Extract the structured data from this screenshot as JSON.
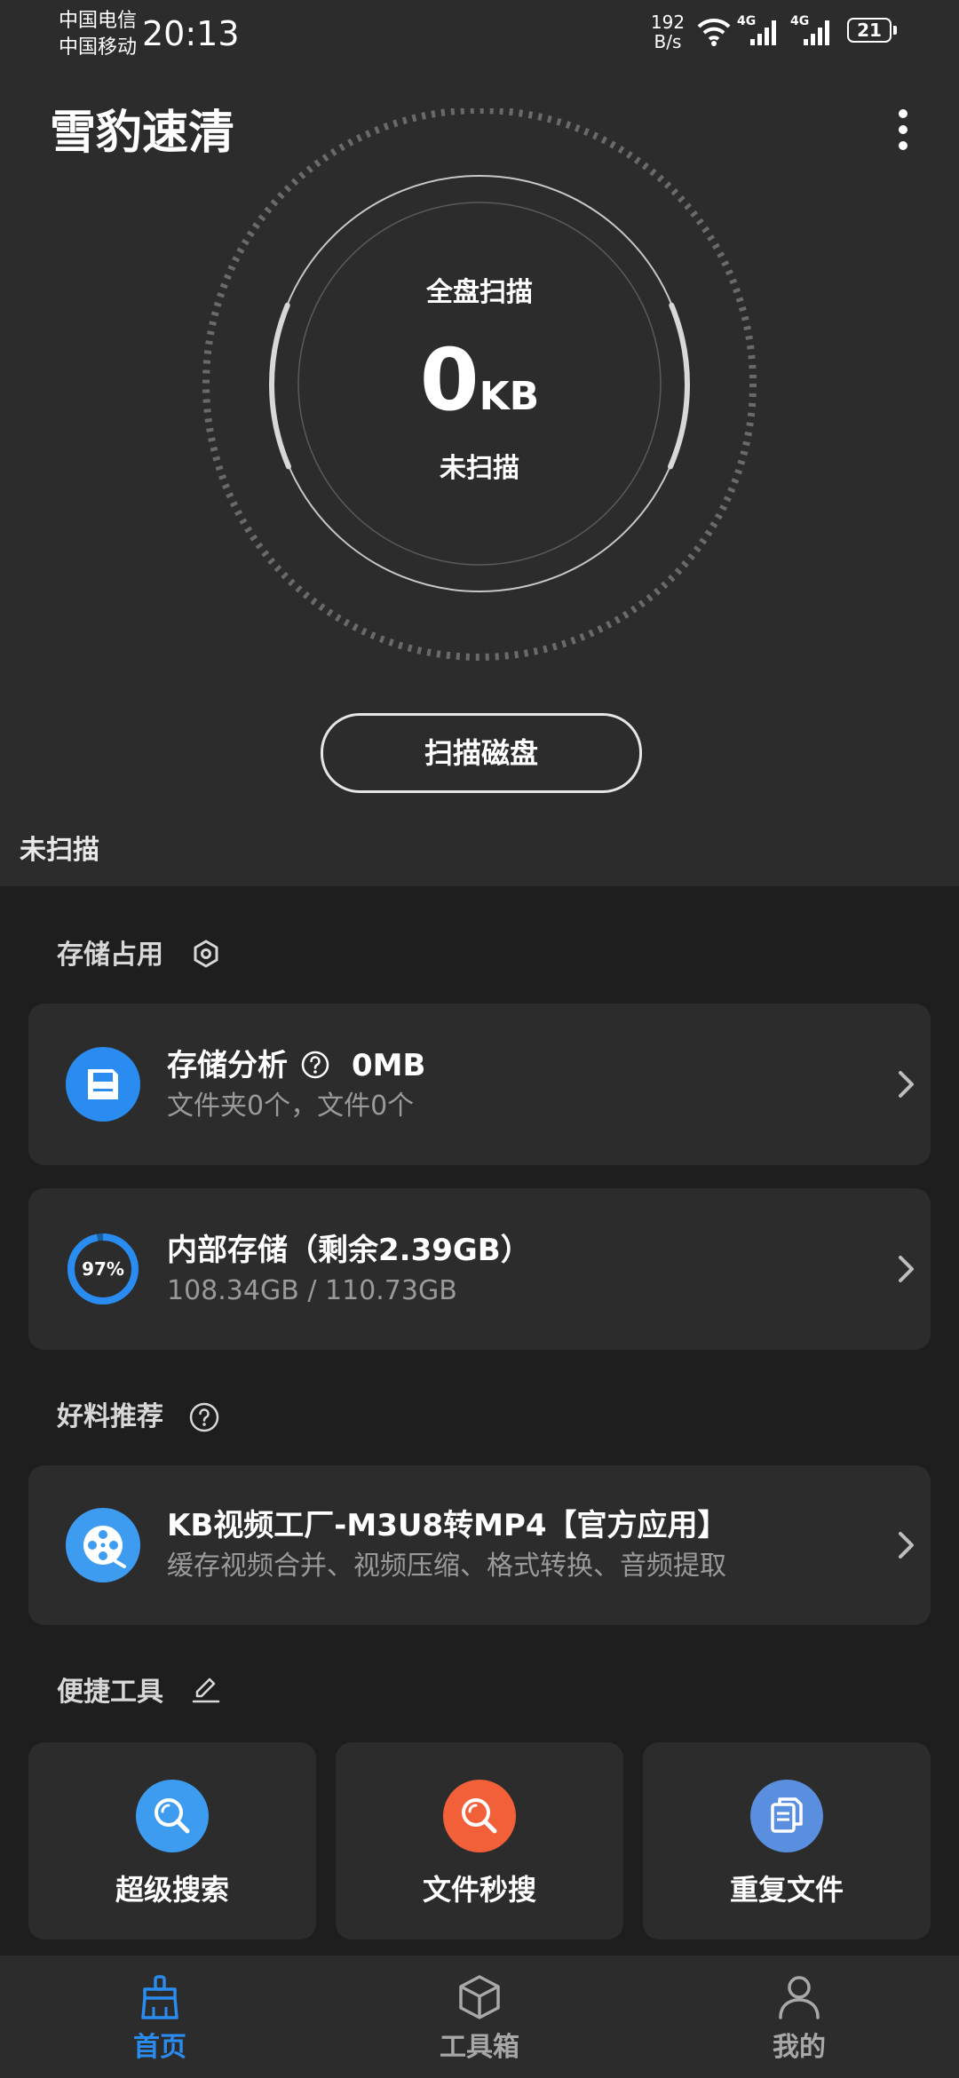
{
  "status_bar": {
    "carrier_1": "中国电信",
    "carrier_2": "中国移动",
    "time": "20:13",
    "net_speed_value": "192",
    "net_speed_unit": "B/s",
    "signal_1_label": "4G",
    "signal_2_label": "4G",
    "battery": "21"
  },
  "header": {
    "title": "雪豹速清",
    "more_icon": "more-vertical-icon"
  },
  "scan_dial": {
    "title": "全盘扫描",
    "size_value": "0",
    "size_unit": "KB",
    "state": "未扫描"
  },
  "scan_button": {
    "label": "扫描磁盘"
  },
  "hero_status": "未扫描",
  "storage_section": {
    "title": "存储占用",
    "icon": "hexagon-settings-icon",
    "analysis": {
      "title": "存储分析",
      "help_icon": "help-circle-icon",
      "size": "0MB",
      "subtitle": "文件夹0个，文件0个",
      "icon": "disk-icon"
    },
    "internal": {
      "title": "内部存储（剩余2.39GB）",
      "subtitle": "108.34GB / 110.73GB",
      "percent_label": "97%",
      "percent_value": 97
    }
  },
  "recommend_section": {
    "title": "好料推荐",
    "icon": "help-circle-icon",
    "item": {
      "title": "KB视频工厂-M3U8转MP4【官方应用】",
      "subtitle": "缓存视频合并、视频压缩、格式转换、音频提取",
      "icon": "film-reel-icon"
    }
  },
  "tools_section": {
    "title": "便捷工具",
    "icon": "edit-icon",
    "tools": [
      {
        "label": "超级搜索",
        "icon": "search-icon",
        "color": "#3d9cf0"
      },
      {
        "label": "文件秒搜",
        "icon": "search-icon",
        "color": "#f2603a"
      },
      {
        "label": "重复文件",
        "icon": "document-copy-icon",
        "color": "#5a8fe0"
      }
    ]
  },
  "bottom_nav": {
    "items": [
      {
        "label": "首页",
        "icon": "broom-icon",
        "active": true
      },
      {
        "label": "工具箱",
        "icon": "box-icon",
        "active": false
      },
      {
        "label": "我的",
        "icon": "user-icon",
        "active": false
      }
    ]
  },
  "colors": {
    "accent": "#2a8cf0",
    "background": "#1e1e1e",
    "card": "#2c2c2c",
    "hero": "#2c2c2c",
    "muted_text": "#9a9a9a",
    "nav_inactive": "#a8a8a8"
  }
}
